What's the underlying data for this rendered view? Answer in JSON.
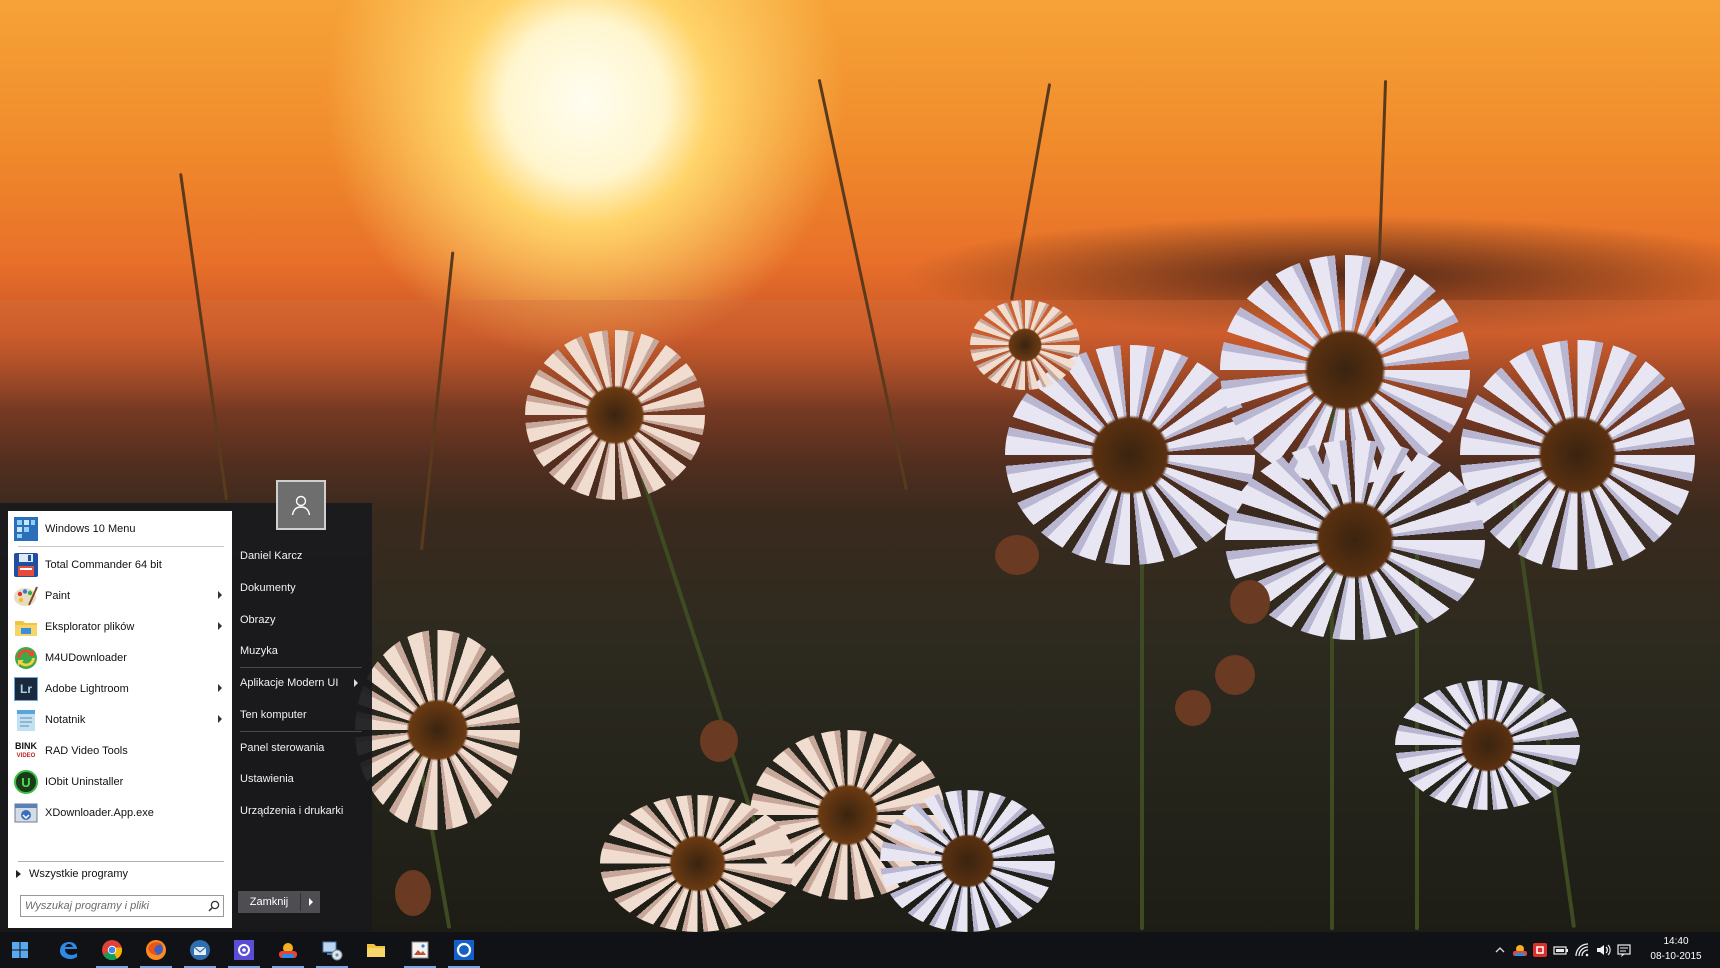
{
  "start_menu": {
    "programs": [
      {
        "label": "Windows 10 Menu",
        "icon": "windows-10-menu-icon",
        "has_submenu": false
      },
      {
        "label": "Total Commander 64 bit",
        "icon": "floppy-disk-icon",
        "has_submenu": false
      },
      {
        "label": "Paint",
        "icon": "paint-palette-icon",
        "has_submenu": true
      },
      {
        "label": "Eksplorator plików",
        "icon": "file-explorer-folder-icon",
        "has_submenu": true
      },
      {
        "label": "M4UDownloader",
        "icon": "green-arrows-icon",
        "has_submenu": false
      },
      {
        "label": "Adobe Lightroom",
        "icon": "lightroom-icon",
        "has_submenu": true
      },
      {
        "label": "Notatnik",
        "icon": "notepad-icon",
        "has_submenu": true
      },
      {
        "label": "RAD Video Tools",
        "icon": "bink-video-icon",
        "has_submenu": false
      },
      {
        "label": "IObit Uninstaller",
        "icon": "iobit-uninstaller-icon",
        "has_submenu": false
      },
      {
        "label": "XDownloader.App.exe",
        "icon": "app-window-icon",
        "has_submenu": false
      }
    ],
    "icon_text": {
      "lightroom": "Lr",
      "bink": "BINK",
      "bink_sub": "VIDEO",
      "iobit": "U"
    },
    "all_programs_label": "Wszystkie programy",
    "search_placeholder": "Wyszukaj programy i pliki",
    "user_name": "Daniel Karcz",
    "right_items": [
      {
        "label": "Dokumenty",
        "has_submenu": false
      },
      {
        "label": "Obrazy",
        "has_submenu": false
      },
      {
        "label": "Muzyka",
        "has_submenu": false
      },
      {
        "label": "Aplikacje Modern UI",
        "has_submenu": true
      },
      {
        "label": "Ten komputer",
        "has_submenu": false
      },
      {
        "label": "Panel sterowania",
        "has_submenu": false
      },
      {
        "label": "Ustawienia",
        "has_submenu": false
      },
      {
        "label": "Urządzenia i drukarki",
        "has_submenu": false
      }
    ],
    "shutdown_label": "Zamknij"
  },
  "taskbar": {
    "pinned": [
      {
        "icon": "start-windows-icon",
        "running": false
      },
      {
        "icon": "edge-browser-icon",
        "running": false
      },
      {
        "icon": "chrome-icon",
        "running": true
      },
      {
        "icon": "firefox-icon",
        "running": true
      },
      {
        "icon": "thunderbird-mail-icon",
        "running": true
      },
      {
        "icon": "settings-gear-app-icon",
        "running": true
      },
      {
        "icon": "weather-app-icon",
        "running": true
      },
      {
        "icon": "network-computer-icon",
        "running": true
      },
      {
        "icon": "file-explorer-icon",
        "running": false
      },
      {
        "icon": "image-viewer-icon",
        "running": true
      },
      {
        "icon": "circle-app-icon",
        "running": true
      }
    ],
    "tray": [
      "chevron-up-icon",
      "weather-tray-icon",
      "red-app-tray-icon",
      "battery-icon",
      "wifi-icon",
      "volume-icon",
      "action-center-icon"
    ],
    "clock_time": "14:40",
    "clock_date": "08-10-2015"
  },
  "colors": {
    "accent": "#7aa7e8",
    "taskbar": "#101216",
    "menu_dark": "#19191c"
  }
}
